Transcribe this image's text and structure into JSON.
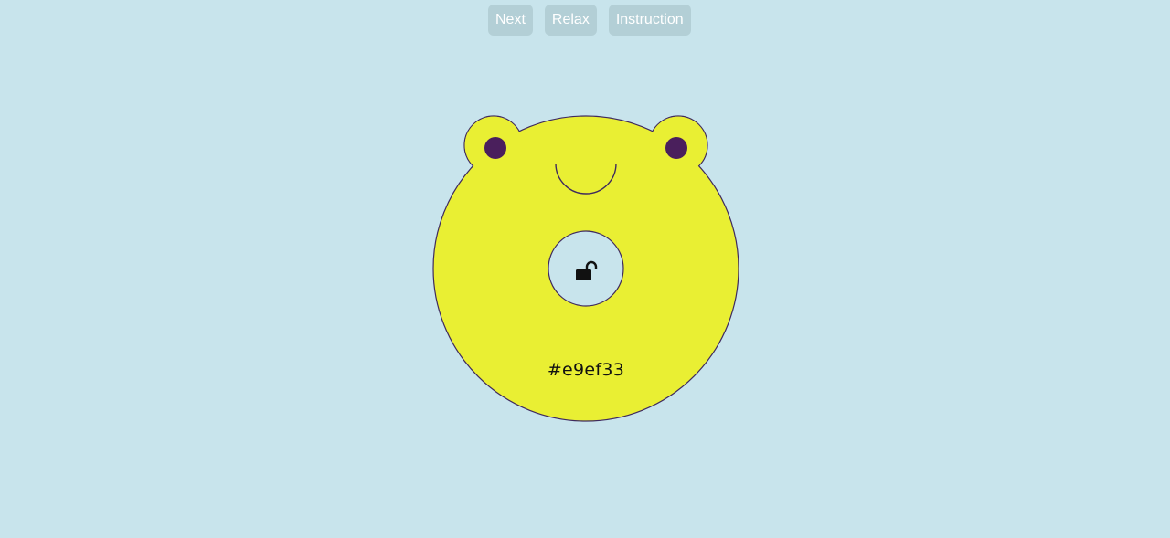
{
  "toolbar": {
    "next_label": "Next",
    "relax_label": "Relax",
    "instruction_label": "Instruction"
  },
  "bear": {
    "color_hex_label": "#e9ef33",
    "body_color": "#e9ef33",
    "outline_color": "#3f2a5e",
    "eye_color": "#4a1f5c",
    "center_color": "#c8e4ec",
    "lock_icon": "unlocked-padlock-icon"
  },
  "colors": {
    "background": "#c8e4ec",
    "button_bg": "#b3cfd6",
    "button_text": "#ffffff"
  }
}
